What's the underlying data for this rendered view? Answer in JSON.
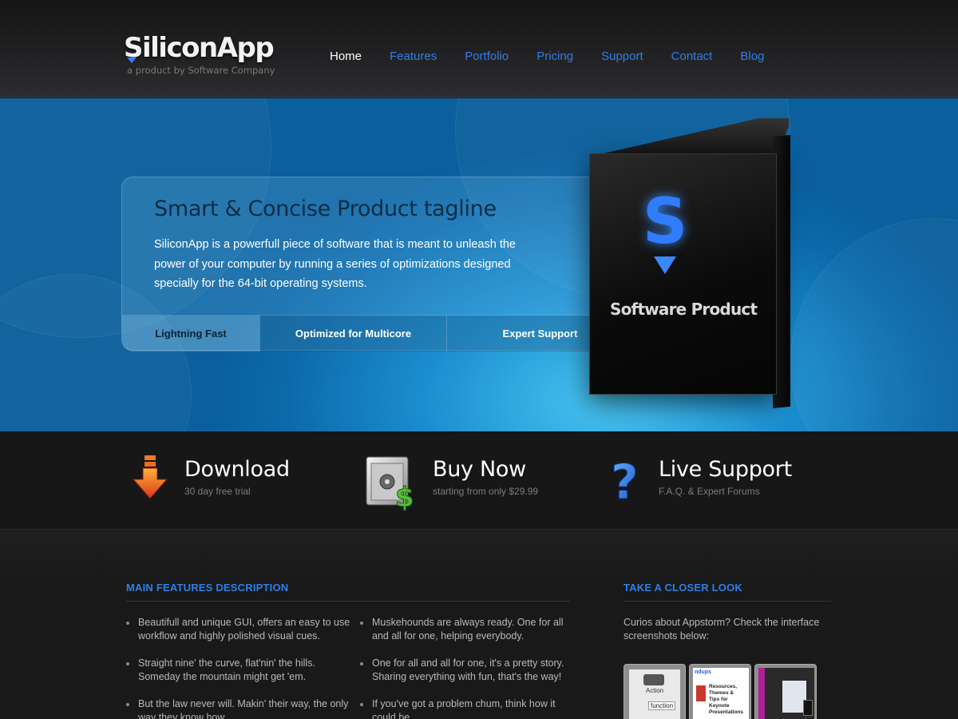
{
  "header": {
    "logo_text": "SiliconApp",
    "logo_subtitle": "a product by Software Company",
    "nav": [
      {
        "label": "Home",
        "active": true
      },
      {
        "label": "Features",
        "active": false
      },
      {
        "label": "Portfolio",
        "active": false
      },
      {
        "label": "Pricing",
        "active": false
      },
      {
        "label": "Support",
        "active": false
      },
      {
        "label": "Contact",
        "active": false
      },
      {
        "label": "Blog",
        "active": false
      }
    ]
  },
  "hero": {
    "tagline": "Smart & Concise Product tagline",
    "description": "SiliconApp is a powerfull piece of software that is meant to unleash the power of your computer by running a series of optimizations designed specially for the 64-bit operating systems.",
    "features": [
      "Lightning Fast",
      "Optimized for Multicore",
      "Expert Support"
    ],
    "box_letter": "S",
    "box_label": "Software Product"
  },
  "cta": [
    {
      "title": "Download",
      "subtitle": "30 day free trial",
      "icon": "download-arrow-icon"
    },
    {
      "title": "Buy Now",
      "subtitle": "starting from only $29.99",
      "icon": "safe-dollar-icon"
    },
    {
      "title": "Live Support",
      "subtitle": "F.A.Q. & Expert Forums",
      "icon": "question-mark-icon"
    }
  ],
  "main_features": {
    "title": "MAIN FEATURES DESCRIPTION",
    "left": [
      "Beautifull and unique GUI, offers an easy to use workflow and highly polished visual cues.",
      "Straight nine' the curve, flat'nin' the hills. Someday the mountain might get 'em.",
      "But the law never will. Makin' their way, the only way they know how"
    ],
    "right": [
      "Muskehounds are always ready. One for all and all for one, helping everybody.",
      "One for all and all for one, it's a pretty story. Sharing everything with fun, that's the way!",
      "If you've got a problem chum, think how it could be"
    ]
  },
  "closer_look": {
    "title": "TAKE A CLOSER LOOK",
    "text": "Curios about Appstorm? Check the interface screenshots below:",
    "thumbs": [
      {
        "caption": "Action",
        "extra": "function"
      },
      {
        "caption": "Resources, Themes & Tips for Keynote Presentations",
        "extra": "ndups"
      },
      {
        "caption": "",
        "extra": ""
      }
    ]
  },
  "colors": {
    "accent": "#2f7fe8",
    "hero_blue": "#1c8fd0",
    "background": "#1b1b1c"
  }
}
